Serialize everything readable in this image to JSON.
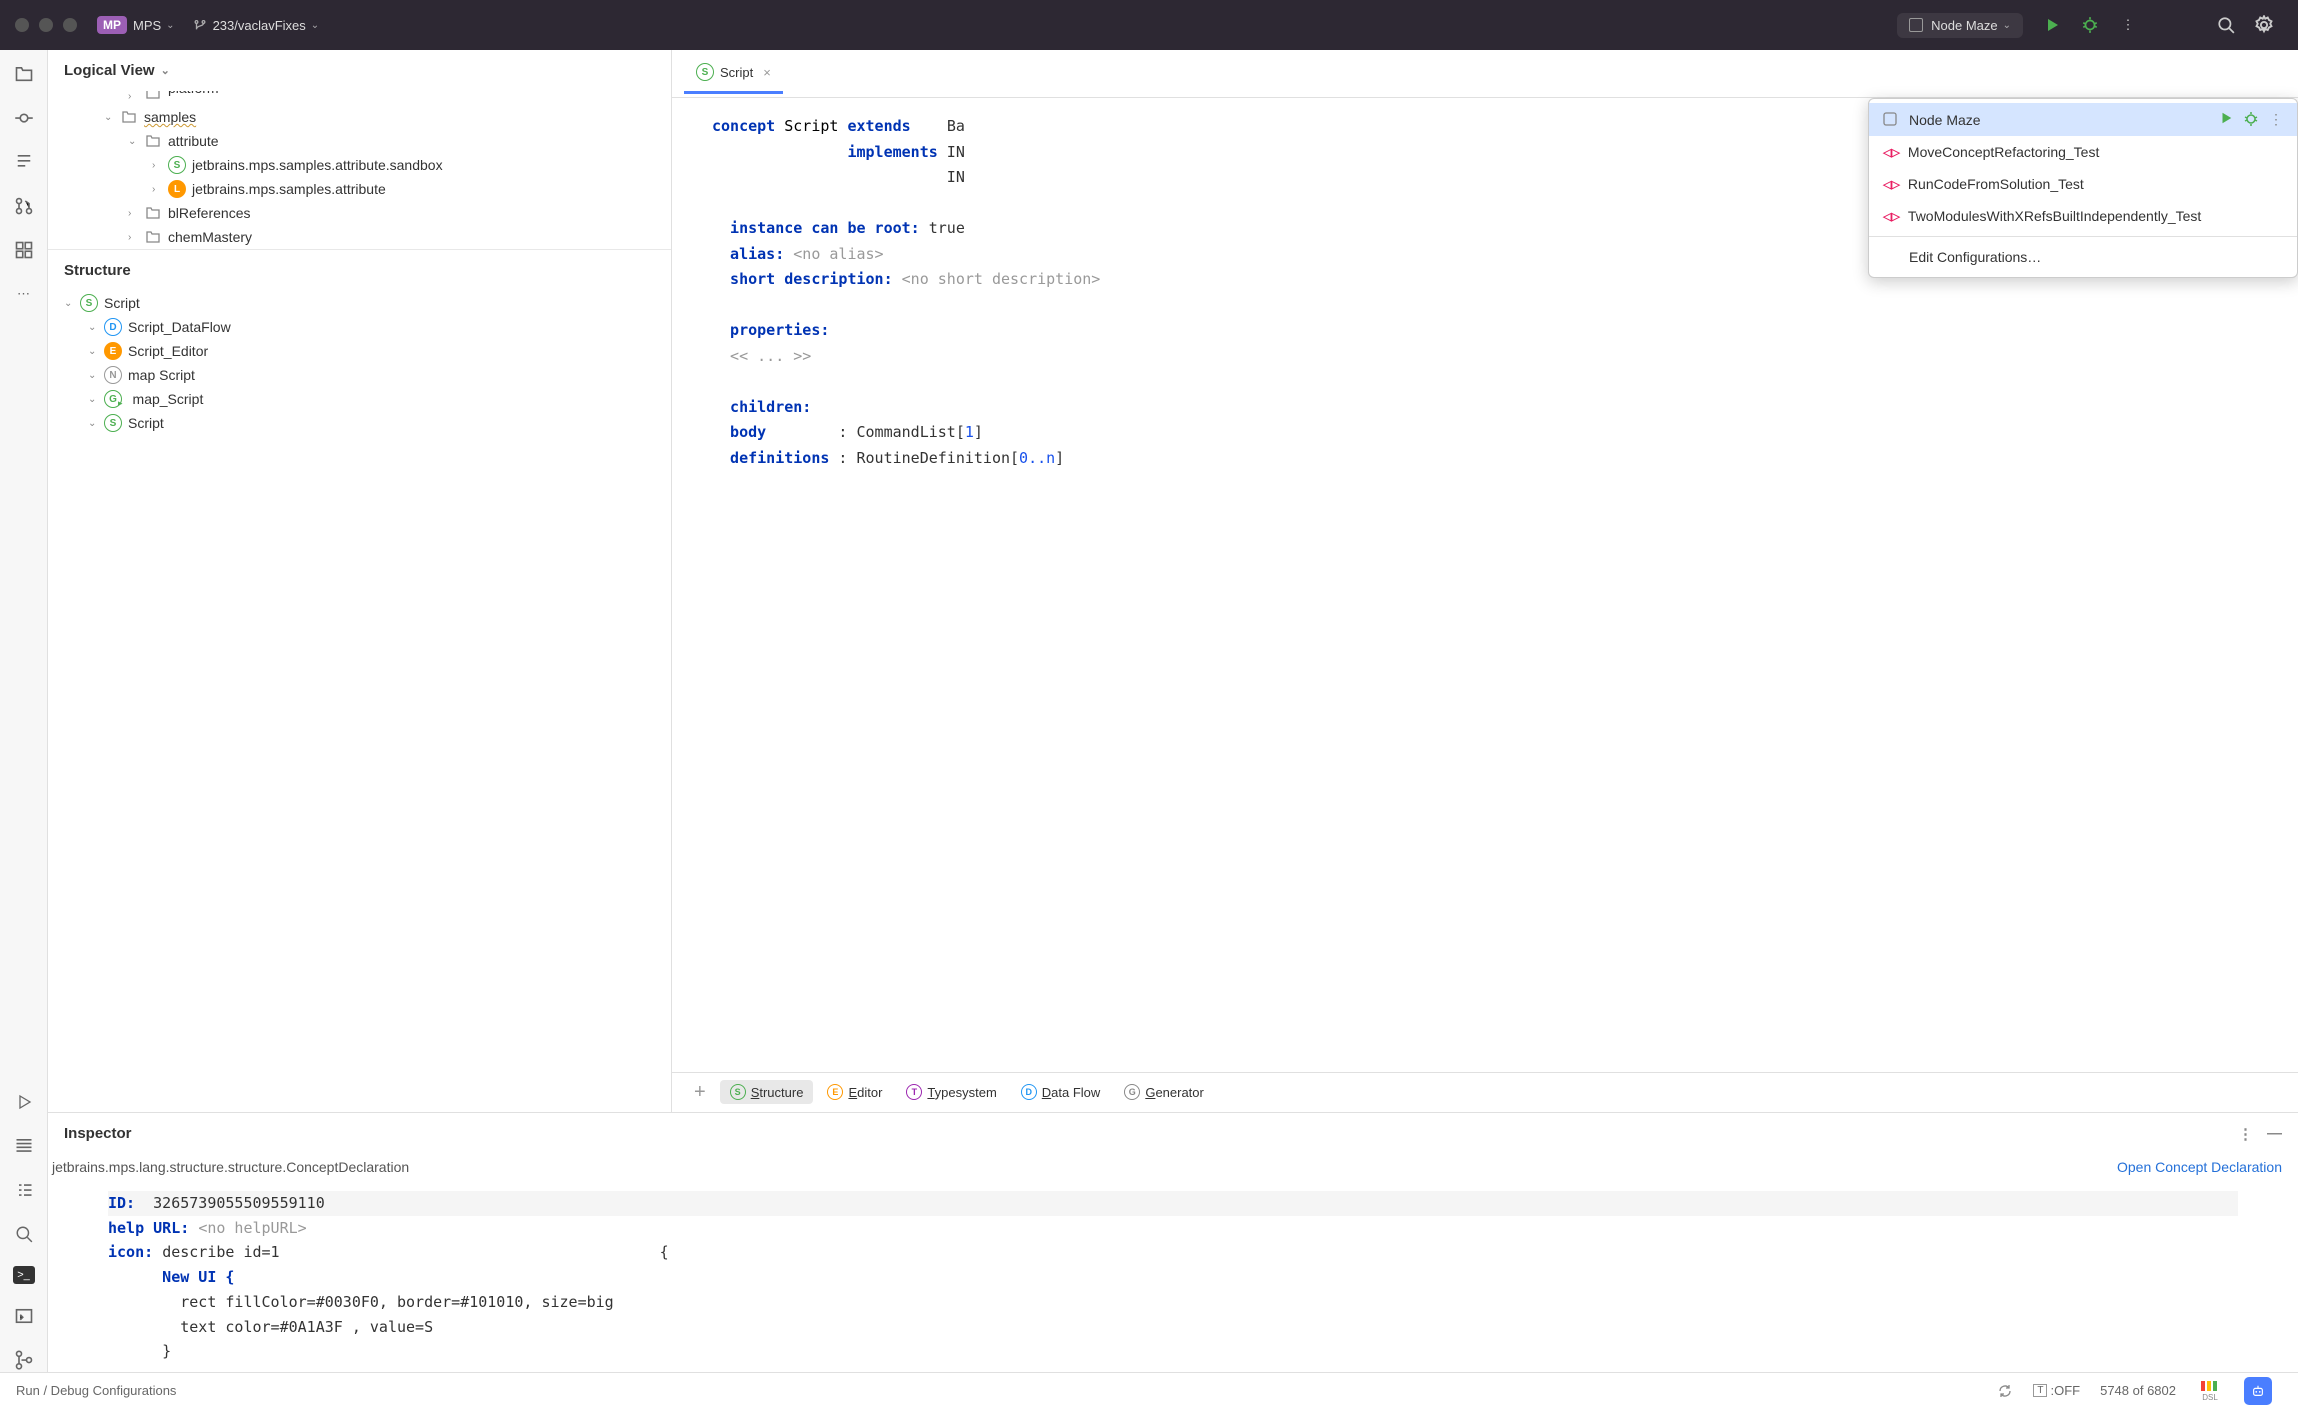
{
  "titlebar": {
    "project_badge": "MP",
    "project_name": "MPS",
    "branch": "233/vaclavFixes",
    "run_config": "Node Maze"
  },
  "logical_view": {
    "title": "Logical View",
    "items": [
      {
        "indent": 3,
        "toggle": "›",
        "icon": "folder",
        "label": "platform",
        "cut": true
      },
      {
        "indent": 2,
        "toggle": "⌄",
        "icon": "folder",
        "label": "samples",
        "wavy": true
      },
      {
        "indent": 3,
        "toggle": "⌄",
        "icon": "folder",
        "label": "attribute"
      },
      {
        "indent": 4,
        "toggle": "›",
        "icon": "S",
        "label": "jetbrains.mps.samples.attribute.sandbox"
      },
      {
        "indent": 4,
        "toggle": "›",
        "icon": "L",
        "label": "jetbrains.mps.samples.attribute"
      },
      {
        "indent": 3,
        "toggle": "›",
        "icon": "folder",
        "label": "blReferences"
      },
      {
        "indent": 3,
        "toggle": "›",
        "icon": "folder",
        "label": "chemMastery"
      }
    ]
  },
  "structure": {
    "title": "Structure",
    "items": [
      {
        "indent": 0,
        "toggle": "⌄",
        "icon": "S",
        "label": "Script"
      },
      {
        "indent": 1,
        "toggle": "⌄",
        "icon": "D",
        "label": "Script_DataFlow"
      },
      {
        "indent": 1,
        "toggle": "⌄",
        "icon": "E",
        "label": "Script_Editor"
      },
      {
        "indent": 1,
        "toggle": "⌄",
        "icon": "N",
        "label": "map Script"
      },
      {
        "indent": 1,
        "toggle": "⌄",
        "icon": "G",
        "label": "map_Script",
        "overlay": true
      },
      {
        "indent": 1,
        "toggle": "⌄",
        "icon": "S",
        "label": "Script"
      }
    ]
  },
  "editor": {
    "tab_label": "Script",
    "lines": {
      "concept_kw": "concept",
      "concept_name": "Script",
      "extends_kw": "extends",
      "extends_val": "Ba",
      "implements_kw": "implements",
      "implements_val1": "IN",
      "implements_val2": "IN",
      "root_label": "instance can be root:",
      "root_val": "true",
      "alias_label": "alias:",
      "alias_val": "<no alias>",
      "shortdesc_label": "short description:",
      "shortdesc_val": "<no short description>",
      "props_label": "properties:",
      "props_placeholder": "<< ... >>",
      "children_label": "children:",
      "body_label": "body",
      "body_type": "CommandList",
      "body_card": "1",
      "defs_label": "definitions",
      "defs_type": "RoutineDefinition",
      "defs_card": "0..n"
    }
  },
  "dropdown": {
    "items": [
      {
        "label": "Node Maze",
        "selected": true,
        "icon": "box",
        "run_actions": true
      },
      {
        "label": "MoveConceptRefactoring_Test",
        "icon": "test"
      },
      {
        "label": "RunCodeFromSolution_Test",
        "icon": "test"
      },
      {
        "label": "TwoModulesWithXRefsBuiltIndependently_Test",
        "icon": "test"
      }
    ],
    "edit_label": "Edit Configurations…"
  },
  "aspect_tabs": [
    {
      "icon": "S",
      "label": "Structure",
      "active": true,
      "color": "#4caf50"
    },
    {
      "icon": "E",
      "label": "Editor",
      "color": "#ff9800"
    },
    {
      "icon": "T",
      "label": "Typesystem",
      "color": "#9c27b0"
    },
    {
      "icon": "D",
      "label": "Data Flow",
      "color": "#2196f3"
    },
    {
      "icon": "G",
      "label": "Generator",
      "color": "#888"
    }
  ],
  "inspector": {
    "title": "Inspector",
    "path": "jetbrains.mps.lang.structure.structure.ConceptDeclaration",
    "link": "Open Concept Declaration",
    "id_label": "ID:",
    "id_val": "3265739055509559110",
    "help_label": "help URL:",
    "help_val": "<no helpURL>",
    "icon_label": "icon:",
    "icon_rest": "describe id=1",
    "brace_open": "{",
    "newui": "New UI {",
    "rect_line": "rect fillColor=#0030F0, border=#101010, size=big",
    "text_line": "text color=#0A1A3F , value=S",
    "brace_close": "}"
  },
  "status_bar": {
    "hint": "Run / Debug Configurations",
    "toff": ":OFF",
    "memory": "5748 of 6802"
  }
}
